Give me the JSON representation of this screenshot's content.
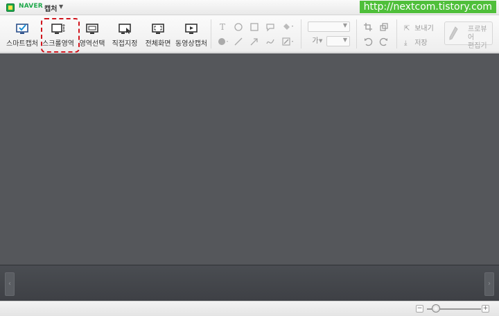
{
  "titlebar": {
    "brand": "NAVER",
    "app_name": "캡처",
    "watermark": "http://nextcom.tistory.com"
  },
  "toolbar": {
    "capture_tools": [
      {
        "label": "스마트캡처",
        "icon": "smart-capture-icon"
      },
      {
        "label": "스크롤영역",
        "icon": "scroll-area-icon"
      },
      {
        "label": "영역선택",
        "icon": "region-select-icon"
      },
      {
        "label": "직접지정",
        "icon": "direct-select-icon"
      },
      {
        "label": "전체화면",
        "icon": "fullscreen-icon"
      },
      {
        "label": "동영상캡처",
        "icon": "video-capture-icon"
      }
    ],
    "highlighted_tool": "스크롤영역",
    "draw_tools": {
      "text_glyph": "T",
      "shapes": [
        "text-tool-icon",
        "ellipse-tool-icon",
        "rectangle-tool-icon",
        "speech-bubble-tool-icon",
        "fill-color-icon",
        "brush-icon",
        "line-tool-icon",
        "arrow-tool-icon",
        "freehand-tool-icon",
        "stroke-color-icon"
      ]
    },
    "font_glyph": "가",
    "send_label": "보내기",
    "save_label": "저장",
    "proview_label_1": "프로뷰어",
    "proview_label_2": "편집기"
  },
  "colors": {
    "brand_green": "#1ea84a",
    "canvas_bg": "#55575b",
    "highlight_red": "#d0141c"
  },
  "zoom": {
    "minus": "−",
    "plus": "+",
    "level": 0.1
  },
  "strip": {
    "prev": "‹",
    "next": "›"
  }
}
